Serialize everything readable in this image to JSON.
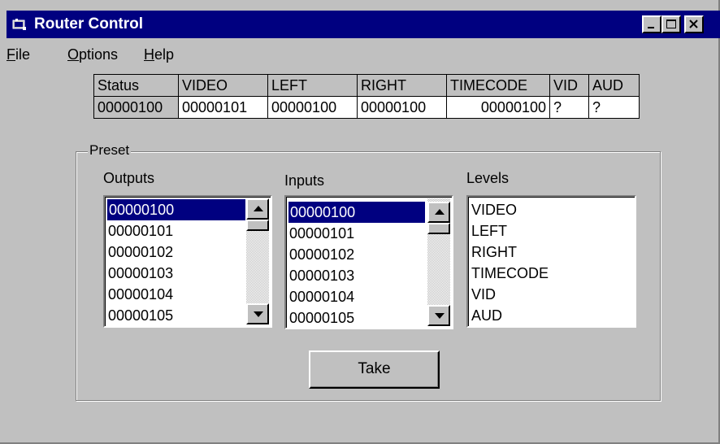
{
  "window": {
    "title": "Router Control"
  },
  "menu": {
    "items": [
      {
        "label": "File",
        "accel": "F",
        "rest": "ile"
      },
      {
        "label": "Options",
        "accel": "O",
        "rest": "ptions"
      },
      {
        "label": "Help",
        "accel": "H",
        "rest": "elp"
      }
    ]
  },
  "status_grid": {
    "headers": [
      "Status",
      "VIDEO",
      "LEFT",
      "RIGHT",
      "TIMECODE",
      "VID",
      "AUD"
    ],
    "values": [
      "00000100",
      "00000101",
      "00000100",
      "00000100",
      "00000100",
      "?",
      "?"
    ]
  },
  "preset": {
    "label": "Preset",
    "outputs": {
      "label": "Outputs",
      "items": [
        "00000100",
        "00000101",
        "00000102",
        "00000103",
        "00000104",
        "00000105"
      ],
      "selected": "00000100"
    },
    "inputs": {
      "label": "Inputs",
      "items": [
        "00000100",
        "00000101",
        "00000102",
        "00000103",
        "00000104",
        "00000105"
      ],
      "selected": "00000100"
    },
    "levels": {
      "label": "Levels",
      "items": [
        "VIDEO",
        "LEFT",
        "RIGHT",
        "TIMECODE",
        "VID",
        "AUD"
      ]
    },
    "take_label": "Take"
  }
}
